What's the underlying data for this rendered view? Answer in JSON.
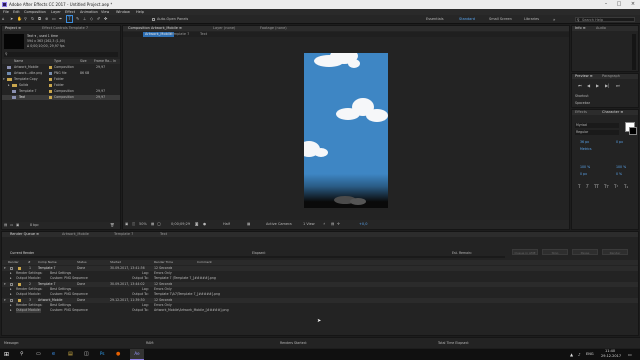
{
  "window": {
    "title": "Adobe After Effects CC 2017 - Untitled Project.aep *"
  },
  "menu": [
    "File",
    "Edit",
    "Composition",
    "Layer",
    "Effect",
    "Animation",
    "View",
    "Window",
    "Help"
  ],
  "toolbar": {
    "auto_open_panels": "Auto-Open Panels",
    "workspaces": [
      "Essentials",
      "Standard",
      "Small Screen",
      "Libraries"
    ],
    "search_placeholder": "Search Help"
  },
  "project_panel": {
    "tabs": [
      "Project ≡",
      "Effect Controls Template 7"
    ],
    "selected_name": "Text ▾ , used 1 time",
    "selected_info1": "594 x 363 (262,3 (1,00)",
    "selected_info2": "Δ 0;00;10;00, 29,97 fps",
    "columns": [
      "Name",
      "Type",
      "Size",
      "Frame Ra...",
      "In"
    ],
    "items": [
      {
        "name": "Artwork_Mobile",
        "type": "Composition",
        "size": "",
        "rate": "29,97",
        "color": "#c9a64d"
      },
      {
        "name": "Artwork...dile.png",
        "type": "PNG file",
        "size": "86 KB",
        "rate": "",
        "color": "#7a8fb0"
      },
      {
        "name": "Template Copy",
        "type": "Folder",
        "size": "",
        "rate": "",
        "color": "#c9a64d"
      },
      {
        "name": "Solids",
        "type": "Folder",
        "size": "",
        "rate": "",
        "color": "#c9a64d"
      },
      {
        "name": "Template 7",
        "type": "Composition",
        "size": "",
        "rate": "29,97",
        "color": "#c9a64d"
      },
      {
        "name": "Text",
        "type": "Composition",
        "size": "",
        "rate": "29,97",
        "color": "#c9a64d"
      }
    ],
    "bpc": "8 bpc"
  },
  "composition_panel": {
    "tabs": [
      "Composition Artwork_Mobile ≡",
      "Layer (none)",
      "Footage (none)"
    ],
    "subtabs": [
      "Artwork_Mobile",
      "Template 7",
      "Text"
    ],
    "zoom": "50%",
    "timecode": "0;00;09;29",
    "resolution": "Half",
    "camera": "Active Camera",
    "views": "1 View",
    "offset": "+0,0"
  },
  "right_panels": {
    "info_tabs": [
      "Info ≡",
      "Audio"
    ],
    "preview_tabs": [
      "Preview ≡",
      "Paragraph"
    ],
    "shortcut_label": "Shortcut",
    "shortcut_value": "Spacebar",
    "effects_tabs": [
      "Effects",
      "Character ≡"
    ],
    "font": "Myriad",
    "font_style": "Regular",
    "font_size": "36 px",
    "tracking": "Metrics",
    "leading": "0 px",
    "scale_v": "100 %",
    "scale_h": "100 %",
    "baseline": "0 px",
    "tsume": "0 %"
  },
  "render_queue": {
    "tabs": [
      "Render Queue ≡",
      "Artwork_Mobile",
      "Template 7",
      "Text"
    ],
    "current_render": "Current Render",
    "elapsed": "Elapsed:",
    "est_remain": "Est. Remain:",
    "buttons": [
      "Queue in AME",
      "Stop",
      "Pause",
      "Render"
    ],
    "columns": [
      "Render",
      "#",
      "Comp Name",
      "Status",
      "Started",
      "Render Time",
      "Comment"
    ],
    "items": [
      {
        "num": "1",
        "comp": "Template 7",
        "status": "Done",
        "started": "30.09.2017, 13:41:36",
        "time": "12 Seconds",
        "settings_label": "Render Settings:",
        "settings": "Best Settings",
        "log_label": "Log:",
        "log": "Errors Only",
        "output_label": "Output Module:",
        "output": "Custom: PNG Sequence",
        "output_to_label": "Output To:",
        "output_to": "Template 7 (Template 7_[#####].png"
      },
      {
        "num": "2",
        "comp": "Template 7",
        "status": "Done",
        "started": "30.09.2017, 13:44:02",
        "time": "12 Seconds",
        "settings_label": "Render Settings:",
        "settings": "Best Settings",
        "log_label": "Log:",
        "log": "Errors Only",
        "output_label": "Output Module:",
        "output": "Custom: PNG Sequence",
        "output_to_label": "Output To:",
        "output_to": "Template 7\\A7\\Template 7_[#####].png"
      },
      {
        "num": "3",
        "comp": "Artwork_Mobile",
        "status": "Done",
        "started": "29.12.2017, 11:39:30",
        "time": "12 Seconds",
        "settings_label": "Render Settings:",
        "settings": "Best Settings",
        "log_label": "Log:",
        "log": "Errors Only",
        "output_label": "Output Module:",
        "output": "Custom: PNG Sequence",
        "output_to_label": "Output To:",
        "output_to": "Artwork_Mobile\\Artwork_Mobile_[#####].png"
      }
    ],
    "footer": {
      "message_label": "Message:",
      "ram_label": "RAM:",
      "renders_started_label": "Renders Started:",
      "total_elapsed_label": "Total Time Elapsed:"
    }
  },
  "taskbar": {
    "time": "11:40",
    "date": "29.12.2017",
    "lang": "ENG"
  },
  "colors": {
    "sky": "#3e86c4",
    "accent": "#2d8ceb",
    "label_yellow": "#c9a64d"
  }
}
